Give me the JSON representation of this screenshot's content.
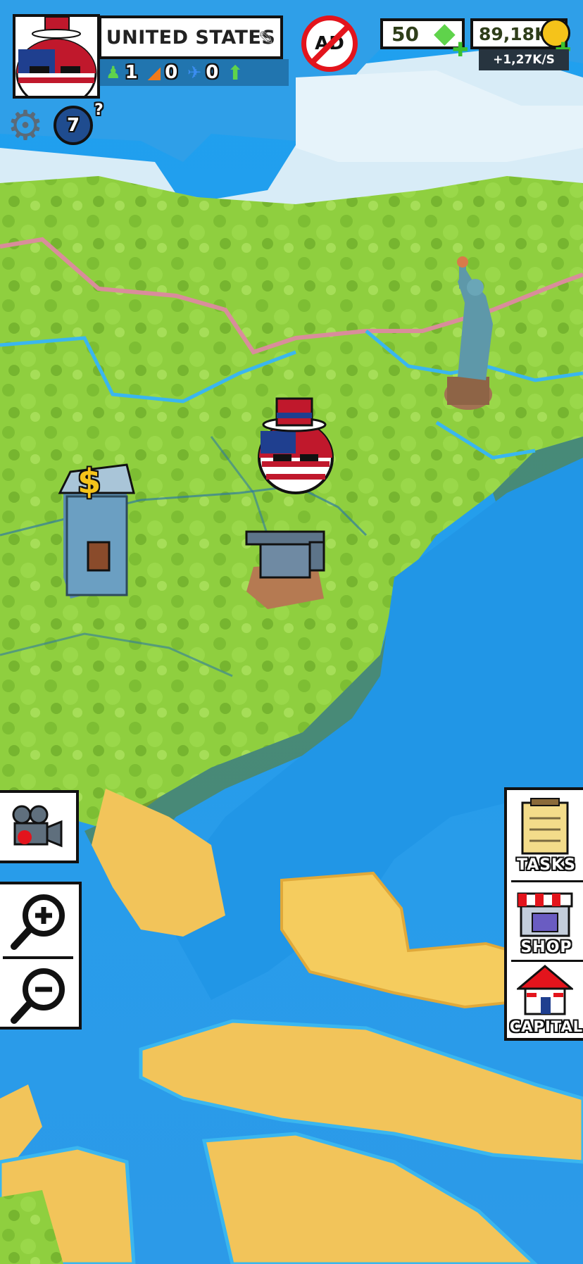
{
  "player": {
    "country_name": "UNITED STATES",
    "units": {
      "infantry": "1",
      "tanks": "0",
      "planes": "0"
    }
  },
  "currency": {
    "gems": "50",
    "coins": "89,18K",
    "income_rate": "+1,27K/S"
  },
  "level": {
    "value": "7",
    "hint": "?"
  },
  "no_ads_label": "AD",
  "right_menu": {
    "tasks_label": "TASKS",
    "shop_label": "SHOP",
    "capital_label": "CAPITAL"
  },
  "building_sign": "$",
  "colors": {
    "ocean": "#2fa3e6",
    "land_green": "#8ccf3e",
    "sand": "#f2c45a",
    "border_red": "#d98d9b",
    "border_blue": "#3ab6ef",
    "gem_green": "#5fd34b",
    "coin_gold": "#f5c31a"
  },
  "icons": [
    "settings-gear-icon",
    "globe-level-icon",
    "infantry-icon",
    "tank-icon",
    "plane-icon",
    "upgrade-arrow-icon",
    "no-ads-icon",
    "gem-icon",
    "coin-icon",
    "video-camera-icon",
    "zoom-in-icon",
    "zoom-out-icon",
    "tasks-clipboard-icon",
    "shop-store-icon",
    "capital-house-icon",
    "edit-pencil-icon"
  ]
}
